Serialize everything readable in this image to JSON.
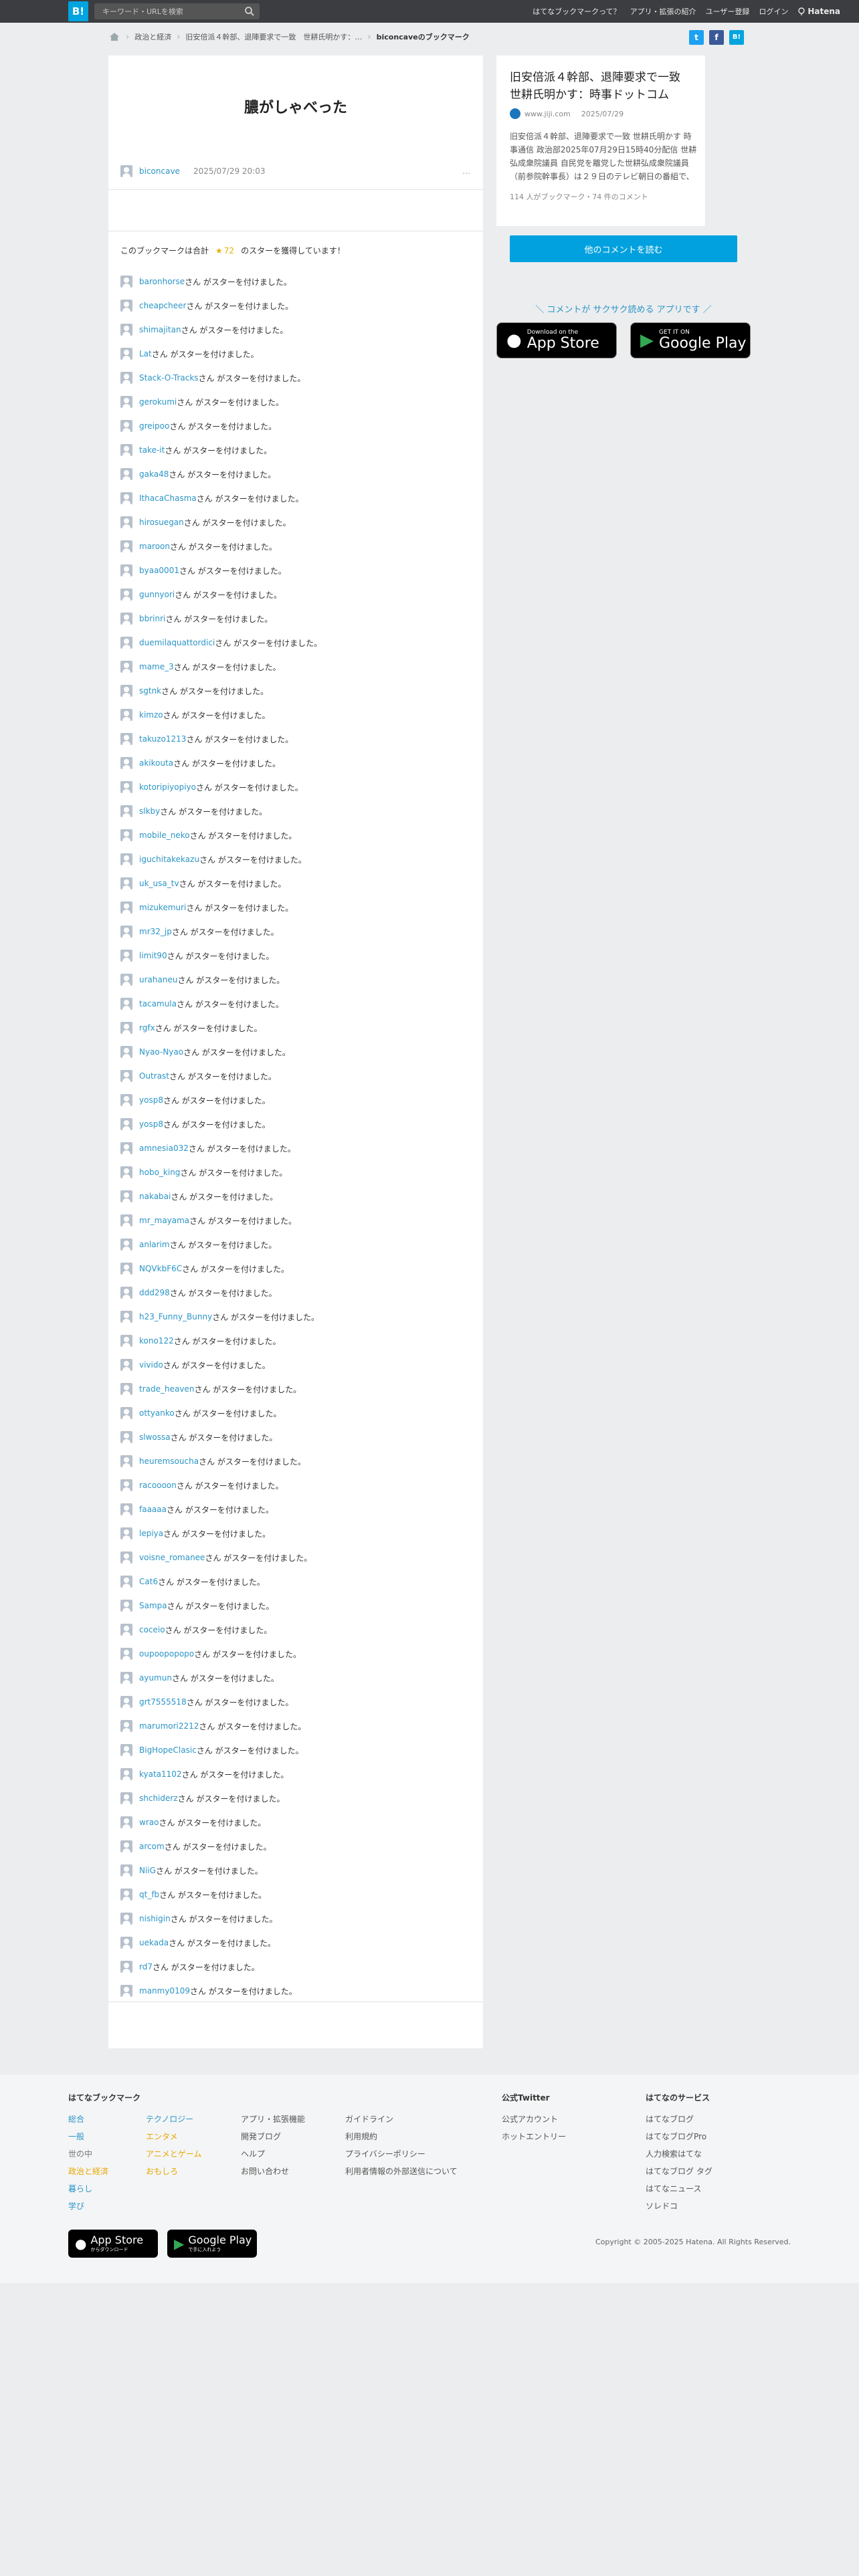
{
  "header": {
    "logo": "B!",
    "search_placeholder": "キーワード・URLを検索",
    "nav": [
      "はてなブックマークって？",
      "アプリ・拡張の紹介",
      "ユーザー登録",
      "ログイン"
    ],
    "hatena": "Hatena"
  },
  "breadcrumb": {
    "category": "政治と経済",
    "article": "旧安倍派４幹部、退陣要求で一致　世耕氏明かす：…",
    "current": "biconcaveのブックマーク"
  },
  "share": {
    "twitter": "t",
    "facebook": "f",
    "hatebu": "B!"
  },
  "bookmark": {
    "comment": "膿がしゃべった",
    "user": "biconcave",
    "date": "2025/07/29 20:03",
    "more": "…"
  },
  "summary": {
    "prefix": "このブックマークは合計",
    "star": "★",
    "count": "72",
    "suffix": "のスターを獲得しています！"
  },
  "star_suffix": "さん がスターを付けました。",
  "stars": [
    "baronhorse",
    "cheapcheer",
    "shimajitan",
    "Lat",
    "Stack-O-Tracks",
    "gerokumi",
    "greipoo",
    "take-it",
    "gaka48",
    "IthacaChasma",
    "hirosuegan",
    "maroon",
    "byaa0001",
    "gunnyori",
    "bbrinri",
    "duemilaquattordici",
    "mame_3",
    "sgtnk",
    "kimzo",
    "takuzo1213",
    "akikouta",
    "kotoripiyopiyo",
    "slkby",
    "mobile_neko",
    "iguchitakekazu",
    "uk_usa_tv",
    "mizukemuri",
    "mr32_jp",
    "limit90",
    "urahaneu",
    "tacamula",
    "rgfx",
    "Nyao-Nyao",
    "Outrast",
    "yosp8",
    "yosp8",
    "amnesia032",
    "hobo_king",
    "nakabai",
    "mr_mayama",
    "anlarim",
    "NQVkbF6C",
    "ddd298",
    "h23_Funny_Bunny",
    "kono122",
    "vivido",
    "trade_heaven",
    "ottyanko",
    "slwossa",
    "heuremsoucha",
    "racoooon",
    "faaaaa",
    "lepiya",
    "voisne_romanee",
    "Cat6",
    "Sampa",
    "coceio",
    "oupoopopopo",
    "ayumun",
    "grt7555518",
    "marumori2212",
    "BigHopeClasic",
    "kyata1102",
    "shchiderz",
    "wrao",
    "arcom",
    "NiiG",
    "qt_fb",
    "nishigin",
    "uekada",
    "rd7",
    "manmy0109"
  ],
  "article": {
    "title": "旧安倍派４幹部、退陣要求で一致　世耕氏明かす：時事ドットコム",
    "domain": "www.jiji.com",
    "date": "2025/07/29",
    "desc": "旧安倍派４幹部、退陣要求で一致 世耕氏明かす 時事通信 政治部2025年07月29日15時40分配信 世耕弘成衆院議員 自民党を離党した世耕弘成衆院議員（前参院幹事長）は２９日のテレビ朝日の番組で、自身を含む旧安…",
    "stats": "114 人がブックマーク・74 件のコメント",
    "read_more": "他のコメントを読む"
  },
  "promo": "＼ コメントが サクサク読める アプリです ／",
  "apps": {
    "apple_small": "Download on the",
    "apple": "App Store",
    "google_small": "GET IT ON",
    "google": "Google Play",
    "apple_small_jp": "からダウンロード",
    "google_small_jp": "で手に入れよう"
  },
  "footer": {
    "heading": "はてなブックマーク",
    "col1": [
      "総合",
      "一般",
      "世の中",
      "政治と経済",
      "暮らし",
      "学び"
    ],
    "col2": [
      "テクノロジー",
      "エンタメ",
      "アニメとゲーム",
      "おもしろ"
    ],
    "col3": [
      "アプリ・拡張機能",
      "開発ブログ",
      "ヘルプ",
      "お問い合わせ"
    ],
    "col4": [
      "ガイドライン",
      "利用規約",
      "プライバシーポリシー",
      "利用者情報の外部送信について"
    ],
    "twitter_heading": "公式Twitter",
    "twitter": [
      "公式アカウント",
      "ホットエントリー"
    ],
    "services_heading": "はてなのサービス",
    "services": [
      "はてなブログ",
      "はてなブログPro",
      "人力検索はてな",
      "はてなブログ タグ",
      "はてなニュース",
      "ソレドコ"
    ],
    "copyright": "Copyright © 2005-2025 Hatena. All Rights Reserved."
  }
}
